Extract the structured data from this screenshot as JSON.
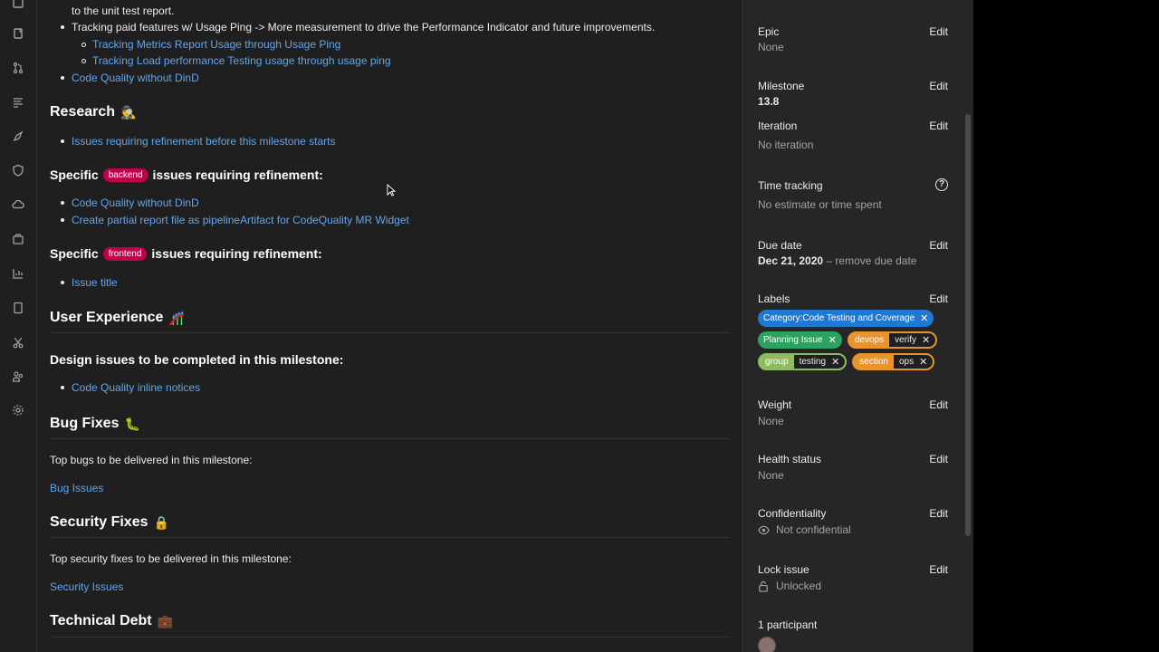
{
  "description": {
    "top_items": [
      {
        "level": 1,
        "text": "to the unit test report.",
        "link": false,
        "bullet": false
      },
      {
        "level": 1,
        "text": "Tracking paid features w/ Usage Ping -> More measurement to drive the Performance Indicator and future improvements.",
        "link": false,
        "bullet": true
      },
      {
        "level": 2,
        "text": "Tracking Metrics Report Usage through Usage Ping",
        "link": true
      },
      {
        "level": 2,
        "text": "Tracking Load performance Testing usage through usage ping",
        "link": true
      },
      {
        "level": 1,
        "text": "Code Quality without DinD",
        "link": true
      }
    ],
    "research": {
      "heading": "Research",
      "emoji": "🕵️",
      "items": [
        "Issues requiring refinement before this milestone starts"
      ]
    },
    "backend": {
      "prefix": "Specific",
      "pill": "backend",
      "suffix": "issues requiring refinement:",
      "items": [
        "Code Quality without DinD",
        "Create partial report file as pipelineArtifact for CodeQuality MR Widget"
      ]
    },
    "frontend": {
      "prefix": "Specific",
      "pill": "frontend",
      "suffix": "issues requiring refinement:",
      "items": [
        "Issue title"
      ]
    },
    "ux": {
      "heading": "User Experience",
      "emoji": "🎢"
    },
    "design": {
      "heading": "Design issues to be completed in this milestone:",
      "items": [
        "Code Quality inline notices"
      ]
    },
    "bugs": {
      "heading": "Bug Fixes",
      "emoji": "🐛",
      "text": "Top bugs to be delivered in this milestone:",
      "link": "Bug Issues"
    },
    "security": {
      "heading": "Security Fixes",
      "emoji": "🔒",
      "text": "Top security fixes to be delivered in this milestone:",
      "link": "Security Issues"
    },
    "techdebt": {
      "heading": "Technical Debt",
      "emoji": "💼"
    }
  },
  "sidebar": {
    "edit_label": "Edit",
    "epic": {
      "title": "Epic",
      "value": "None"
    },
    "milestone": {
      "title": "Milestone",
      "value": "13.8"
    },
    "iteration": {
      "title": "Iteration",
      "value": "No iteration"
    },
    "time_tracking": {
      "title": "Time tracking",
      "value": "No estimate or time spent",
      "help": "?"
    },
    "due_date": {
      "title": "Due date",
      "value": "Dec 21, 2020",
      "remove": "– remove due date"
    },
    "labels": {
      "title": "Labels",
      "items": [
        {
          "key": "Category:Code Testing and Coverage",
          "value": "",
          "color": "#1f78d1",
          "scoped": false
        },
        {
          "key": "Planning Issue",
          "value": "",
          "color": "#2da160",
          "scoped": false
        },
        {
          "key": "devops",
          "value": "verify",
          "color": "#e8932e",
          "scoped": true
        },
        {
          "key": "group",
          "value": "testing",
          "color": "#8fbc63",
          "scoped": true
        },
        {
          "key": "section",
          "value": "ops",
          "color": "#e8932e",
          "scoped": true
        }
      ]
    },
    "weight": {
      "title": "Weight",
      "value": "None"
    },
    "health": {
      "title": "Health status",
      "value": "None"
    },
    "confidentiality": {
      "title": "Confidentiality",
      "value": "Not confidential"
    },
    "lock": {
      "title": "Lock issue",
      "value": "Unlocked"
    },
    "participants": {
      "title": "1 participant"
    }
  }
}
